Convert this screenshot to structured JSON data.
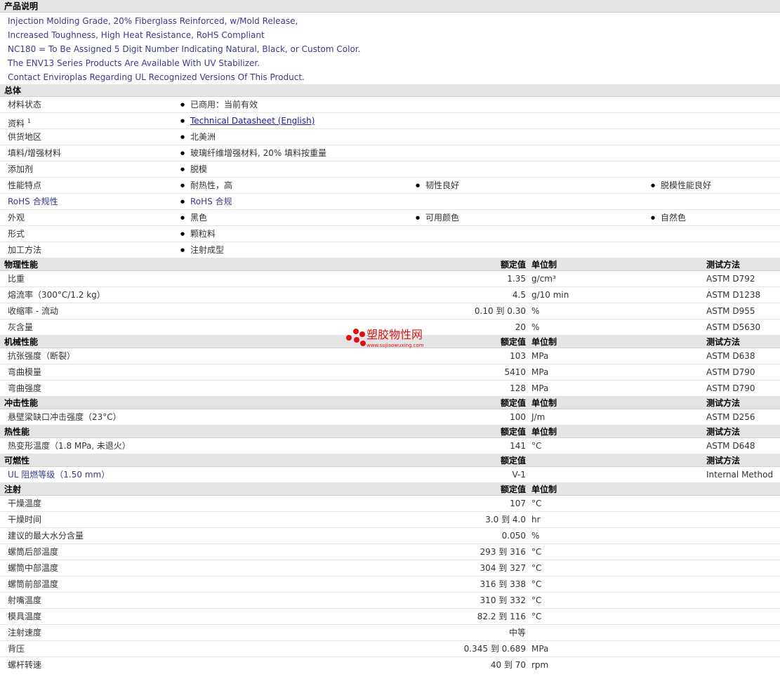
{
  "desc": {
    "title": "产品说明",
    "lines": [
      "Injection Molding Grade, 20% Fiberglass Reinforced, w/Mold Release,",
      "Increased Toughness, High Heat Resistance, RoHS Compliant",
      "NC180 = To Be Assigned 5 Digit Number Indicating Natural, Black, or Custom Color.",
      "The ENV13 Series Products Are Available With UV Stabilizer.",
      "Contact Enviroplas Regarding UL Recognized Versions Of This Product."
    ]
  },
  "general": {
    "title": "总体",
    "rows": [
      {
        "label": "材料状态",
        "b1": "已商用：当前有效"
      },
      {
        "label": "资料",
        "sup": "1",
        "link": "Technical Datasheet (English)"
      },
      {
        "label": "供货地区",
        "b1": "北美洲"
      },
      {
        "label": "填料/增强材料",
        "b1": "玻璃纤维增强材料, 20% 填料按重量"
      },
      {
        "label": "添加剂",
        "b1": "脱模"
      },
      {
        "label": "性能特点",
        "b1": "耐热性，高",
        "b2": "韧性良好",
        "b3": "脱模性能良好"
      },
      {
        "label": "RoHS 合规性",
        "b1": "RoHS 合规"
      },
      {
        "label": "外观",
        "b1": "黑色",
        "b2": "可用颜色",
        "b3": "自然色"
      },
      {
        "label": "形式",
        "b1": "颗粒料"
      },
      {
        "label": "加工方法",
        "b1": "注射成型"
      }
    ]
  },
  "cols": {
    "rated": "额定值",
    "unit": "单位制",
    "method": "测试方法"
  },
  "physical": {
    "title": "物理性能",
    "rows": [
      {
        "label": "比重",
        "value": "1.35",
        "unit": "g/cm³",
        "method": "ASTM D792"
      },
      {
        "label": "熔流率（300°C/1.2 kg）",
        "value": "4.5",
        "unit": "g/10 min",
        "method": "ASTM D1238"
      },
      {
        "label": "收缩率 - 流动",
        "value": "0.10 到  0.30",
        "unit": "%",
        "method": "ASTM D955"
      },
      {
        "label": "灰含量",
        "value": "20",
        "unit": "%",
        "method": "ASTM D5630"
      }
    ]
  },
  "mechanical": {
    "title": "机械性能",
    "rows": [
      {
        "label": "抗张强度（断裂）",
        "value": "103",
        "unit": "MPa",
        "method": "ASTM D638"
      },
      {
        "label": "弯曲模量",
        "value": "5410",
        "unit": "MPa",
        "method": "ASTM D790"
      },
      {
        "label": "弯曲强度",
        "value": "128",
        "unit": "MPa",
        "method": "ASTM D790"
      }
    ]
  },
  "impact": {
    "title": "冲击性能",
    "rows": [
      {
        "label": "悬壁梁缺口冲击强度（23°C）",
        "value": "100",
        "unit": "J/m",
        "method": "ASTM D256"
      }
    ]
  },
  "thermal": {
    "title": "热性能",
    "rows": [
      {
        "label": "热变形温度（1.8 MPa, 未退火）",
        "value": "141",
        "unit": "°C",
        "method": "ASTM D648"
      }
    ]
  },
  "flammability": {
    "title": "可燃性",
    "rows": [
      {
        "label": "UL 阻燃等级（1.50 mm）",
        "value": "V-1",
        "unit": "",
        "method": "Internal Method"
      }
    ]
  },
  "injection": {
    "title": "注射",
    "rows": [
      {
        "label": "干燥温度",
        "value": "107",
        "unit": "°C"
      },
      {
        "label": "干燥时间",
        "value": "3.0 到  4.0",
        "unit": "hr"
      },
      {
        "label": "建议的最大水分含量",
        "value": "0.050",
        "unit": "%"
      },
      {
        "label": "螺筒后部温度",
        "value": "293 到  316",
        "unit": "°C"
      },
      {
        "label": "螺筒中部温度",
        "value": "304 到  327",
        "unit": "°C"
      },
      {
        "label": "螺筒前部温度",
        "value": "316 到  338",
        "unit": "°C"
      },
      {
        "label": "射嘴温度",
        "value": "310 到  332",
        "unit": "°C"
      },
      {
        "label": "模具温度",
        "value": "82.2 到  116",
        "unit": "°C"
      },
      {
        "label": "注射速度",
        "value": "中等",
        "unit": ""
      },
      {
        "label": "背压",
        "value": "0.345 到  0.689",
        "unit": "MPa"
      },
      {
        "label": "螺杆转速",
        "value": "40 到  70",
        "unit": "rpm"
      }
    ]
  },
  "watermark": {
    "name": "塑胶物性网",
    "url": "www.sujiaowuxing.com"
  }
}
